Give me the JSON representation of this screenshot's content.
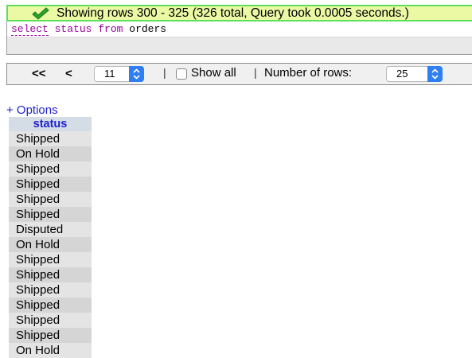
{
  "banner": {
    "message": "Showing rows 300 - 325 (326 total, Query took 0.0005 seconds.)",
    "icon": "check-icon",
    "border_color": "#5ae05a",
    "background_color": "#ebf8a4"
  },
  "sql": {
    "kw_select": "select",
    "col": "status",
    "kw_from": "from",
    "table": "orders"
  },
  "nav": {
    "first_label": "<<",
    "prev_label": "<",
    "page_value": "11",
    "separator1": "|",
    "show_all_label": "Show all",
    "separator2": "|",
    "rows_label": "Number of rows:",
    "rows_value": "25",
    "accent_color": "#2f7ff2"
  },
  "options_label": "+ Options",
  "table": {
    "header": "status",
    "rows": [
      "Shipped",
      "On Hold",
      "Shipped",
      "Shipped",
      "Shipped",
      "Shipped",
      "Disputed",
      "On Hold",
      "Shipped",
      "Shipped",
      "Shipped",
      "Shipped",
      "Shipped",
      "Shipped",
      "On Hold"
    ]
  }
}
